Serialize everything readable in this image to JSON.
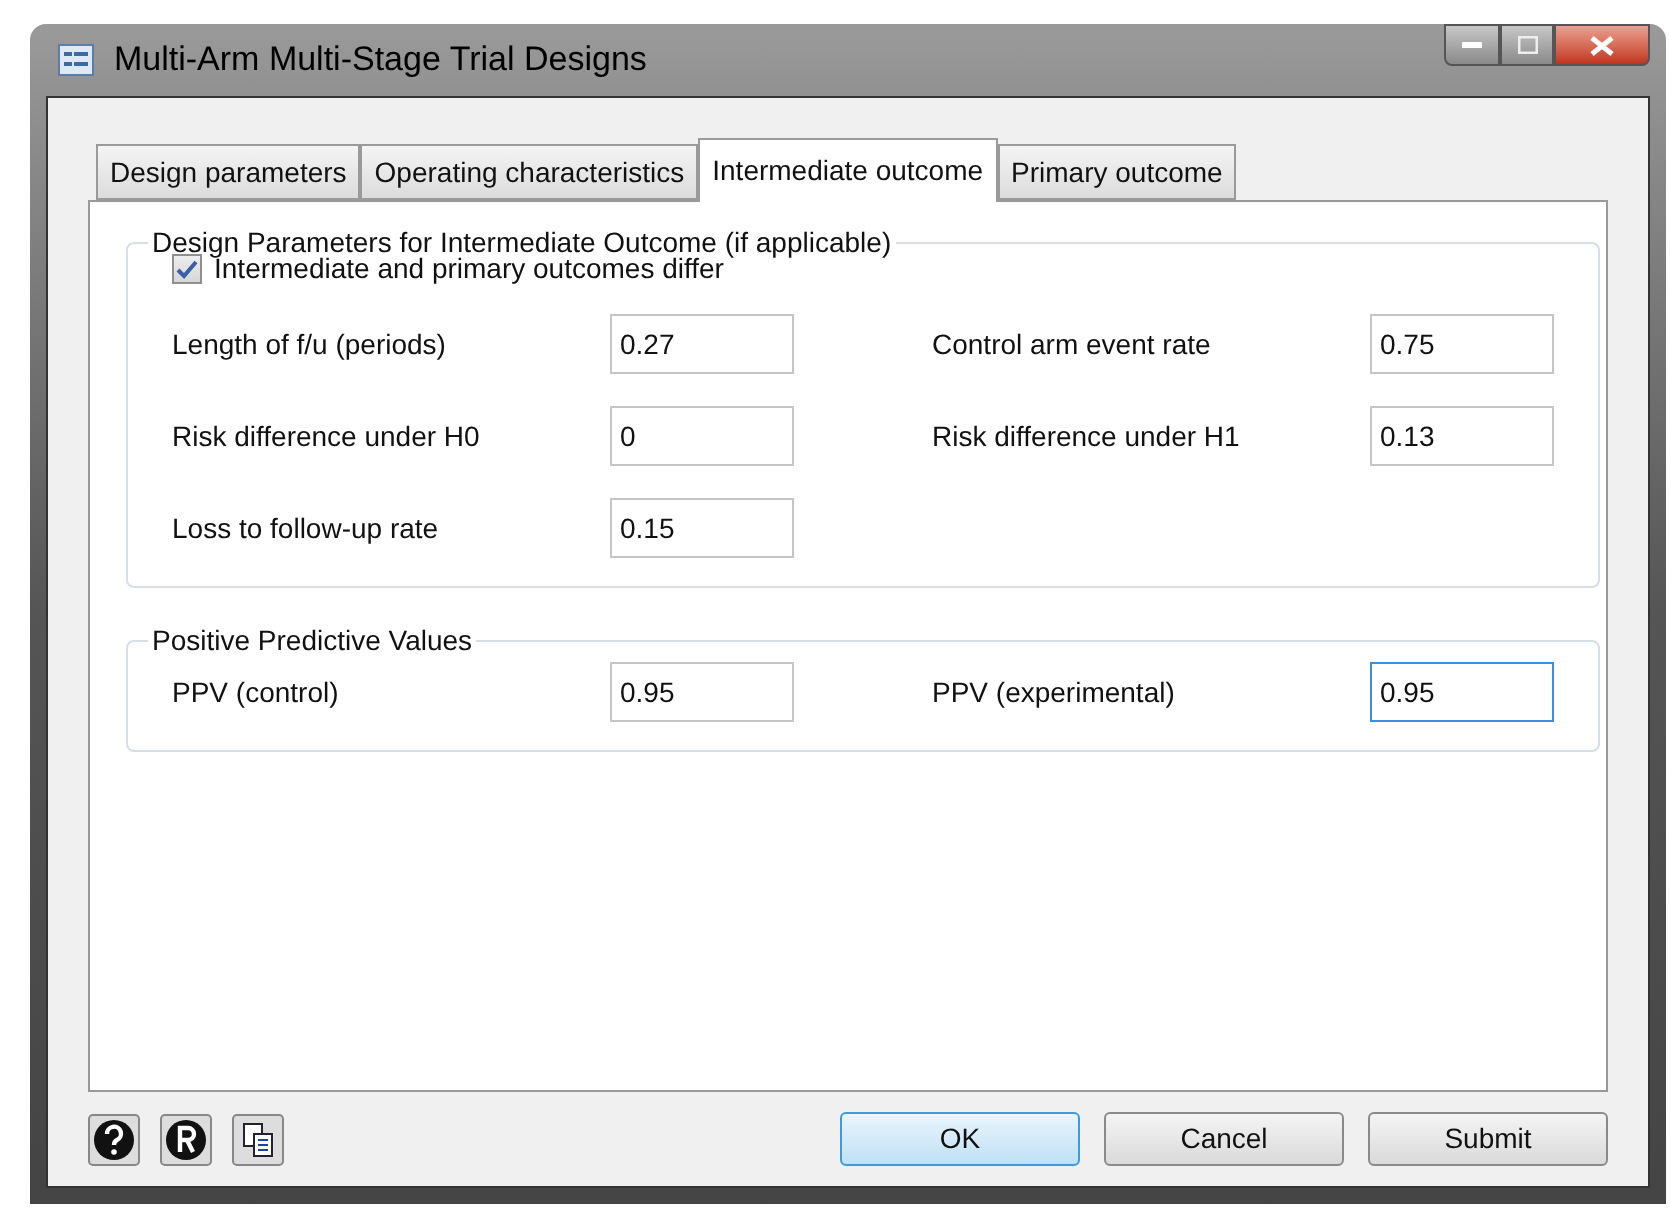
{
  "window": {
    "title": "Multi-Arm Multi-Stage Trial Designs"
  },
  "tabs": [
    {
      "label": "Design parameters",
      "selected": false
    },
    {
      "label": "Operating characteristics",
      "selected": false
    },
    {
      "label": "Intermediate outcome",
      "selected": true
    },
    {
      "label": "Primary outcome",
      "selected": false
    }
  ],
  "groups": [
    {
      "title": "Design Parameters for Intermediate Outcome (if applicable)",
      "checkbox": {
        "label": "Intermediate and primary outcomes differ",
        "checked": true
      },
      "fields": [
        {
          "label": "Length of f/u (periods)",
          "value": "0.27",
          "focused": false
        },
        {
          "label": "Control arm event rate",
          "value": "0.75",
          "focused": false
        },
        {
          "label": "Risk difference under H0",
          "value": "0",
          "focused": false
        },
        {
          "label": "Risk difference under H1",
          "value": "0.13",
          "focused": false
        },
        {
          "label": "Loss to follow-up rate",
          "value": "0.15",
          "focused": false
        }
      ]
    },
    {
      "title": "Positive Predictive Values",
      "fields": [
        {
          "label": "PPV (control)",
          "value": "0.95",
          "focused": false
        },
        {
          "label": "PPV (experimental)",
          "value": "0.95",
          "focused": true
        }
      ]
    }
  ],
  "buttons": [
    {
      "label": "OK",
      "default": true
    },
    {
      "label": "Cancel",
      "default": false
    },
    {
      "label": "Submit",
      "default": false
    }
  ]
}
